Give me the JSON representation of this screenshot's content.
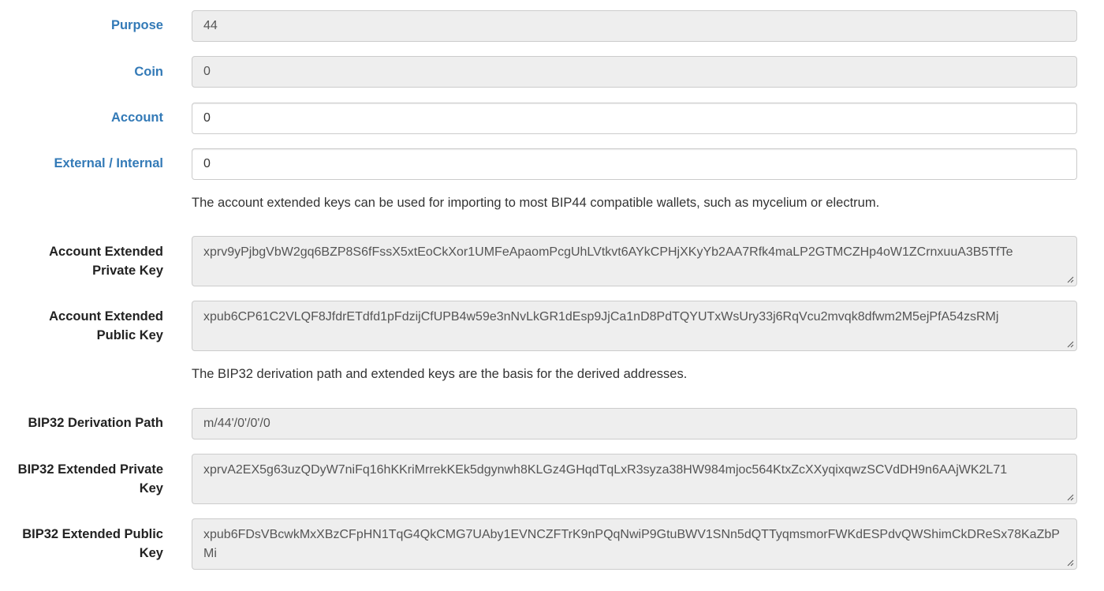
{
  "fields": {
    "purpose": {
      "label": "Purpose",
      "value": "44"
    },
    "coin": {
      "label": "Coin",
      "value": "0"
    },
    "account": {
      "label": "Account",
      "value": "0"
    },
    "external_internal": {
      "label": "External / Internal",
      "value": "0"
    },
    "account_help": "The account extended keys can be used for importing to most BIP44 compatible wallets, such as mycelium or electrum.",
    "account_xprv": {
      "label": "Account Extended\nPrivate Key",
      "value": "xprv9yPjbgVbW2gq6BZP8S6fFssX5xtEoCkXor1UMFeApaomPcgUhLVtkvt6AYkCPHjXKyYb2AA7Rfk4maLP2GTMCZHp4oW1ZCrnxuuA3B5TfTe"
    },
    "account_xpub": {
      "label": "Account Extended\nPublic Key",
      "value": "xpub6CP61C2VLQF8JfdrETdfd1pFdzijCfUPB4w59e3nNvLkGR1dEsp9JjCa1nD8PdTQYUTxWsUry33j6RqVcu2mvqk8dfwm2M5ejPfA54zsRMj"
    },
    "bip32_help": "The BIP32 derivation path and extended keys are the basis for the derived addresses.",
    "bip32_path": {
      "label": "BIP32 Derivation Path",
      "value": "m/44'/0'/0'/0"
    },
    "bip32_xprv": {
      "label": "BIP32 Extended Private\nKey",
      "value": "xprvA2EX5g63uzQDyW7niFq16hKKriMrrekKEk5dgynwh8KLGz4GHqdTqLxR3syza38HW984mjoc564KtxZcXXyqixqwzSCVdDH9n6AAjWK2L71"
    },
    "bip32_xpub": {
      "label": "BIP32 Extended Public\nKey",
      "value": "xpub6FDsVBcwkMxXBzCFpHN1TqG4QkCMG7UAby1EVNCZFTrK9nPQqNwiP9GtuBWV1SNn5dQTTyqmsmorFWKdESPdvQWShimCkDReSx78KaZbPMi"
    }
  },
  "colors": {
    "link_label": "#337ab7",
    "readonly_bg": "#eeeeee",
    "border": "#cccccc"
  },
  "icons": {
    "resize_grip": "resize-grip-icon"
  }
}
